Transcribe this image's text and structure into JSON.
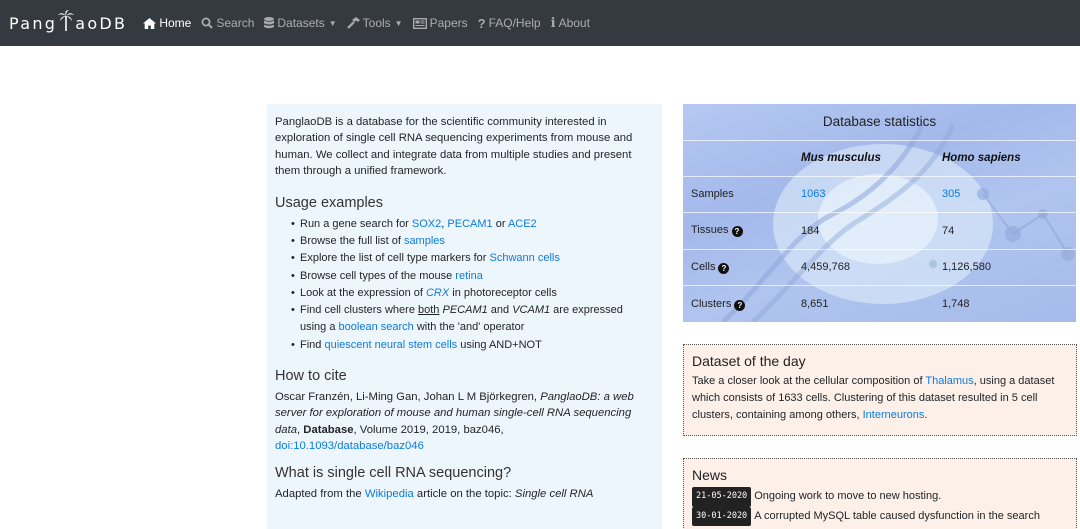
{
  "nav": {
    "brand": {
      "before": "Pang",
      "after": "aoDB"
    },
    "items": [
      {
        "name": "home",
        "label": "Home",
        "icon": "home-icon",
        "active": true
      },
      {
        "name": "search",
        "label": "Search",
        "icon": "search-icon"
      },
      {
        "name": "datasets",
        "label": "Datasets",
        "icon": "database-icon",
        "dropdown": true
      },
      {
        "name": "tools",
        "label": "Tools",
        "icon": "hammer-icon",
        "dropdown": true
      },
      {
        "name": "papers",
        "label": "Papers",
        "icon": "newspaper-icon"
      },
      {
        "name": "faq",
        "label": "FAQ/Help",
        "icon": "question-icon"
      },
      {
        "name": "about",
        "label": "About",
        "icon": "info-icon"
      }
    ]
  },
  "intro": "PanglaoDB is a database for the scientific community interested in exploration of single cell RNA sequencing experiments from mouse and human. We collect and integrate data from multiple studies and present them through a unified framework.",
  "usage": {
    "heading": "Usage examples",
    "items": {
      "i0": {
        "t1": "Run a gene search for ",
        "l1": "SOX2",
        "t2": ", ",
        "l2": "PECAM1",
        "t3": " or ",
        "l3": "ACE2"
      },
      "i1": {
        "t1": "Browse the full list of ",
        "l1": "samples"
      },
      "i2": {
        "t1": "Explore the list of cell type markers for ",
        "l1": "Schwann cells"
      },
      "i3": {
        "t1": "Browse cell types of the mouse ",
        "l1": "retina"
      },
      "i4": {
        "t1": "Look at the expression of ",
        "l1": "CRX",
        "t2": " in photoreceptor cells"
      },
      "i5": {
        "t1": "Find cell clusters where ",
        "u1": "both",
        "t2": " ",
        "e1": "PECAM1",
        "t3": " and ",
        "e2": "VCAM1",
        "t4": " are expressed",
        "t5": "using a ",
        "l1": "boolean search",
        "t6": " with the 'and' operator"
      },
      "i6": {
        "t1": "Find ",
        "l1": "quiescent neural stem cells",
        "t2": " using AND+NOT"
      }
    }
  },
  "cite": {
    "heading": "How to cite",
    "authors": "Oscar Franzén, Li-Ming Gan, Johan L M Björkegren, ",
    "title": "PanglaoDB: a web server for exploration of mouse and human single-cell RNA sequencing data",
    "sep": ", ",
    "journal": "Database",
    "rest": ", Volume 2019, 2019, baz046, ",
    "doi": "doi:10.1093/database/baz046"
  },
  "scrnaseq": {
    "heading": "What is single cell RNA sequencing?",
    "t1": "Adapted from the ",
    "link": "Wikipedia",
    "t2": " article on the topic: ",
    "em": "Single cell RNA"
  },
  "stats": {
    "title": "Database statistics",
    "col1": "Mus musculus",
    "col2": "Homo sapiens",
    "rows": [
      {
        "label": "Samples",
        "help": false,
        "v1": "1063",
        "v2": "305",
        "links": true
      },
      {
        "label": "Tissues",
        "help": true,
        "v1": "184",
        "v2": "74"
      },
      {
        "label": "Cells",
        "help": true,
        "v1": "4,459,768",
        "v2": "1,126,580"
      },
      {
        "label": "Clusters",
        "help": true,
        "v1": "8,651",
        "v2": "1,748"
      }
    ]
  },
  "dotd": {
    "heading": "Dataset of the day",
    "t1": "Take a closer look at the cellular composition of ",
    "l1": "Thalamus",
    "t2": ", using a dataset which consists of 1633 cells. Clustering of this dataset resulted in 5 cell clusters, containing among others, ",
    "l2": "Interneurons",
    "t3": "."
  },
  "news": {
    "heading": "News",
    "items": [
      {
        "date": "21-05-2020",
        "text": "Ongoing work to move to new hosting."
      },
      {
        "date": "30-01-2020",
        "text": "A corrupted MySQL table caused dysfunction in the search"
      }
    ]
  },
  "colors": {
    "navbar": "#343a40",
    "link": "#0b7bdc",
    "left_bg": "#eef6fd",
    "box_bg": "#fdf0e9"
  }
}
